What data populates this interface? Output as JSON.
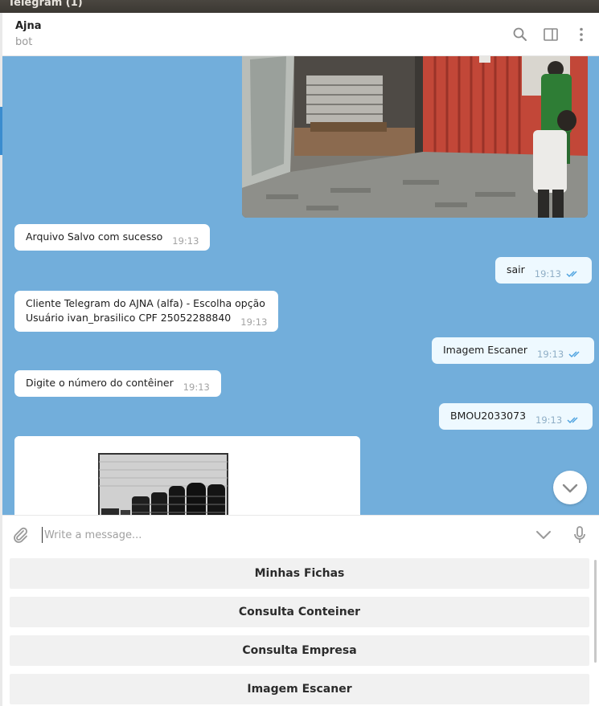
{
  "window": {
    "title": "Telegram (1)"
  },
  "header": {
    "chat_name": "Ajna",
    "status": "bot"
  },
  "messages": [
    {
      "dir": "in",
      "text": "Arquivo Salvo com sucesso",
      "time": "19:13"
    },
    {
      "dir": "out",
      "text": "sair",
      "time": "19:13",
      "read": true
    },
    {
      "dir": "in",
      "lines": [
        "Cliente Telegram do AJNA (alfa) - Escolha opção",
        "Usuário ivan_brasilico CPF 25052288840"
      ],
      "time": "19:13"
    },
    {
      "dir": "out",
      "text": "Imagem Escaner",
      "time": "19:13",
      "read": true
    },
    {
      "dir": "in",
      "text": "Digite o número do contêiner",
      "time": "19:13"
    },
    {
      "dir": "out",
      "text": "BMOU2033073",
      "time": "19:13",
      "read": true
    }
  ],
  "composer": {
    "placeholder": "Write a message..."
  },
  "keyboard": {
    "buttons": [
      "Minhas Fichas",
      "Consulta Conteiner",
      "Consulta Empresa",
      "Imagem Escaner"
    ]
  },
  "icons": {
    "search": "search-icon",
    "sidebar": "sidebar-toggle-icon",
    "menu": "more-vertical-icon",
    "attach": "paperclip-icon",
    "emoji_menu": "chevron-down-icon",
    "voice": "microphone-icon",
    "scroll": "chevron-down-icon",
    "read": "double-check-icon"
  },
  "colors": {
    "chat_background": "#72aedb",
    "incoming_bubble": "#ffffff",
    "outgoing_bubble": "#eef9ff",
    "read_ticks": "#4fa3e0"
  }
}
